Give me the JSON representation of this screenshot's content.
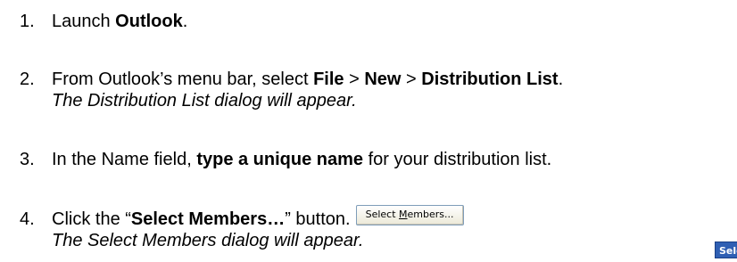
{
  "steps": [
    {
      "number": "1.",
      "parts": [
        "Launch ",
        "Outlook",
        "."
      ]
    },
    {
      "number": "2.",
      "parts": [
        "From Outlook’s menu bar, select ",
        "File",
        " > ",
        "New",
        " > ",
        "Distribution List",
        "."
      ],
      "note": "The Distribution List dialog will appear."
    },
    {
      "number": "3.",
      "parts": [
        "In the Name field, ",
        "type a unique name",
        " for your distribution list."
      ]
    },
    {
      "number": "4.",
      "parts": [
        "Click the “",
        "Select Members…",
        "” button."
      ],
      "button_label_prefix": "Select ",
      "button_label_underlined": "M",
      "button_label_suffix": "embers...",
      "note": "The Select Members dialog will appear."
    }
  ],
  "corner_button_label": "Sele"
}
